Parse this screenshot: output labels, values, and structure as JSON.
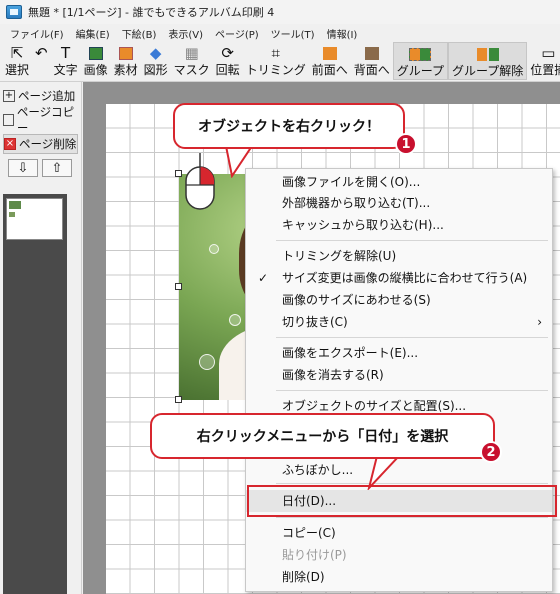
{
  "window": {
    "title": "無題 * [1/1ページ] - 誰でもできるアルバム印刷 4"
  },
  "menubar": [
    "ファイル(F)",
    "編集(E)",
    "下絵(B)",
    "表示(V)",
    "ページ(P)",
    "ツール(T)",
    "情報(I)"
  ],
  "toolbar": [
    {
      "label": "選択",
      "icon": "cursor-icon"
    },
    {
      "label": "元に戻す",
      "icon": "undo-icon"
    },
    {
      "label": "文字",
      "icon": "text-icon"
    },
    {
      "label": "画像",
      "icon": "image-icon"
    },
    {
      "label": "素材",
      "icon": "material-icon"
    },
    {
      "label": "図形",
      "icon": "shape-icon"
    },
    {
      "label": "マスク",
      "icon": "mask-icon"
    },
    {
      "label": "回転",
      "icon": "rotate-icon"
    },
    {
      "label": "トリミング",
      "icon": "crop-icon"
    },
    {
      "label": "前面へ",
      "icon": "bring-front-icon"
    },
    {
      "label": "背面へ",
      "icon": "send-back-icon"
    },
    {
      "label": "グループ",
      "icon": "group-icon"
    },
    {
      "label": "グループ解除",
      "icon": "ungroup-icon"
    },
    {
      "label": "位置揃",
      "icon": "align-icon"
    }
  ],
  "left_panel": {
    "add_page": "ページ追加",
    "copy_page": "ページコピー",
    "delete_page": "ページ削除",
    "down_arrow": "⇩",
    "up_arrow": "⇧"
  },
  "context_menu": {
    "items": [
      {
        "label": "画像ファイルを開く(O)...",
        "state": "normal"
      },
      {
        "label": "外部機器から取り込む(T)...",
        "state": "normal"
      },
      {
        "label": "キャッシュから取り込む(H)...",
        "state": "normal"
      },
      {
        "label": "トリミングを解除(U)",
        "state": "normal"
      },
      {
        "label": "サイズ変更は画像の縦横比に合わせて行う(A)",
        "state": "checked"
      },
      {
        "label": "画像のサイズにあわせる(S)",
        "state": "normal"
      },
      {
        "label": "切り抜き(C)",
        "state": "submenu"
      },
      {
        "label": "画像をエクスポート(E)...",
        "state": "normal"
      },
      {
        "label": "画像を消去する(R)",
        "state": "normal"
      },
      {
        "label": "オブジェクトのサイズと配置(S)...",
        "state": "normal"
      },
      {
        "label": "ふちぼかし...",
        "state": "normal"
      },
      {
        "label": "日付(D)...",
        "state": "highlighted"
      },
      {
        "label": "コピー(C)",
        "state": "normal"
      },
      {
        "label": "貼り付け(P)",
        "state": "disabled"
      },
      {
        "label": "削除(D)",
        "state": "normal"
      }
    ],
    "check_glyph": "✓",
    "submenu_glyph": "›"
  },
  "callouts": {
    "step1": "オブジェクトを右クリック！",
    "step1_number": "1",
    "step2": "右クリックメニューから「日付」を選択",
    "step2_number": "2"
  },
  "colors": {
    "accent": "#d7262e",
    "badge": "#c8102e",
    "highlight": "#e5e5e5"
  }
}
